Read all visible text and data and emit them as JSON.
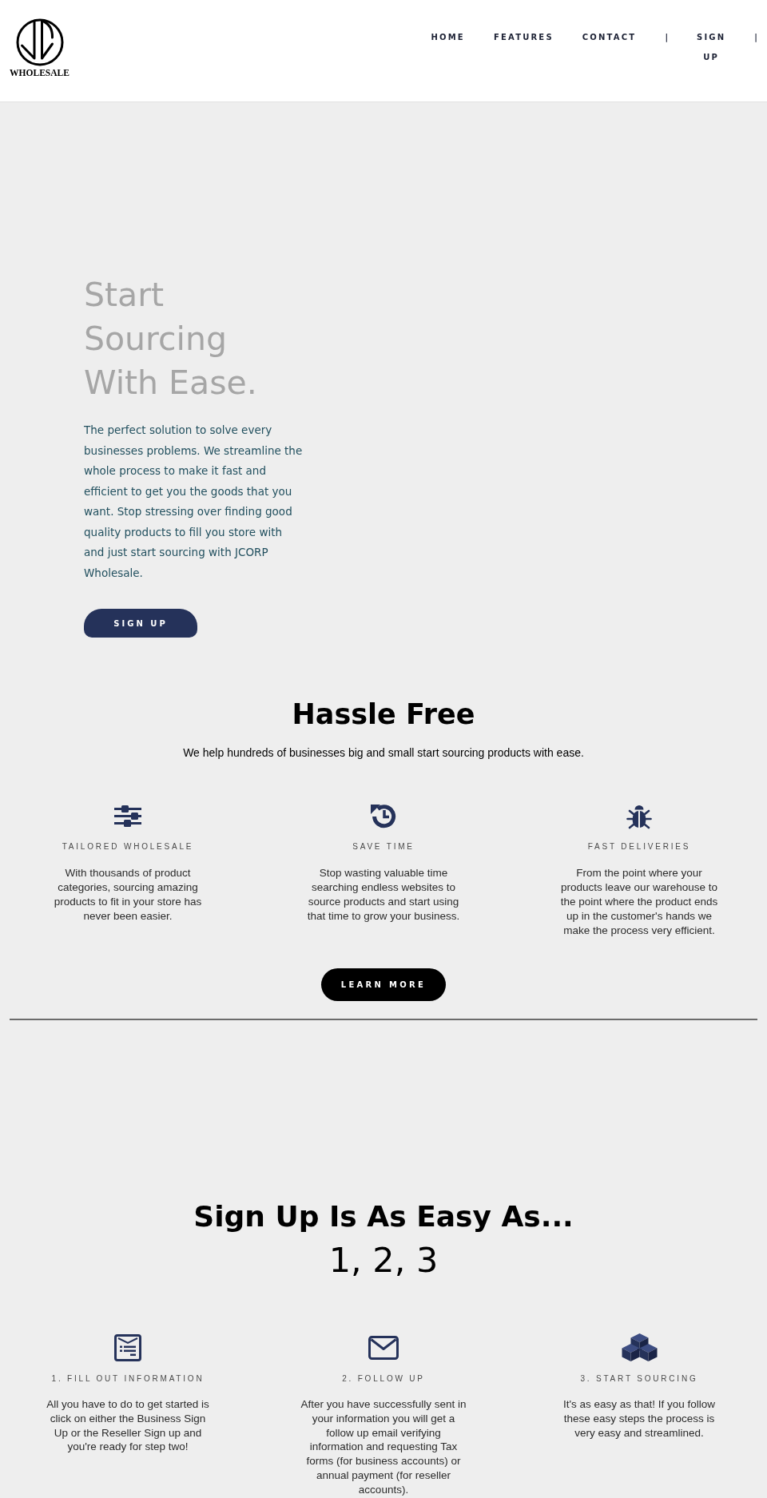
{
  "header": {
    "logo_text": "WHOLESALE",
    "nav": [
      {
        "kind": "link",
        "label": "HOME"
      },
      {
        "kind": "link",
        "label": "FEATURES"
      },
      {
        "kind": "link",
        "label": "CONTACT"
      },
      {
        "kind": "separator",
        "label": "|"
      },
      {
        "kind": "link",
        "label": "SIGN UP"
      },
      {
        "kind": "separator",
        "label": "|"
      }
    ]
  },
  "hero": {
    "title": "Start Sourcing With Ease.",
    "text": "The perfect solution to solve every businesses problems. We streamline the whole process to make it fast and efficient to get you the goods that you want. Stop stressing over finding good quality products to fill you store with and just start sourcing with JCORP Wholesale.",
    "button": "SIGN UP"
  },
  "features": {
    "title": "Hassle Free",
    "subtitle": "We help hundreds of businesses big and small start sourcing products with ease.",
    "items": [
      {
        "title": "TAILORED WHOLESALE",
        "text": "With thousands of product categories, sourcing amazing products to fit in your store has never been easier."
      },
      {
        "title": "SAVE TIME",
        "text": "Stop wasting valuable time searching endless websites to source products and start using that time to grow your business."
      },
      {
        "title": "FAST DELIVERIES",
        "text": "From the point where your products leave our warehouse to the point where the product ends up in the customer's hands we make the process very efficient."
      }
    ],
    "button": "LEARN MORE"
  },
  "steps": {
    "title": "Sign Up Is As Easy As...",
    "subtitle": "1, 2, 3",
    "items": [
      {
        "title": "1. FILL OUT INFORMATION",
        "text": "All you have to do to get started is click on either the Business Sign Up or the Reseller Sign up and you're ready for step two!"
      },
      {
        "title": "2. FOLLOW UP",
        "text": "After you have successfully sent in your information you will get a follow up email verifying information and requesting Tax forms (for business accounts) or annual payment (for reseller accounts)."
      },
      {
        "title": "3. START SOURCING",
        "text": "It's as easy as that! If you follow these easy steps the process is very easy and streamlined."
      }
    ]
  }
}
